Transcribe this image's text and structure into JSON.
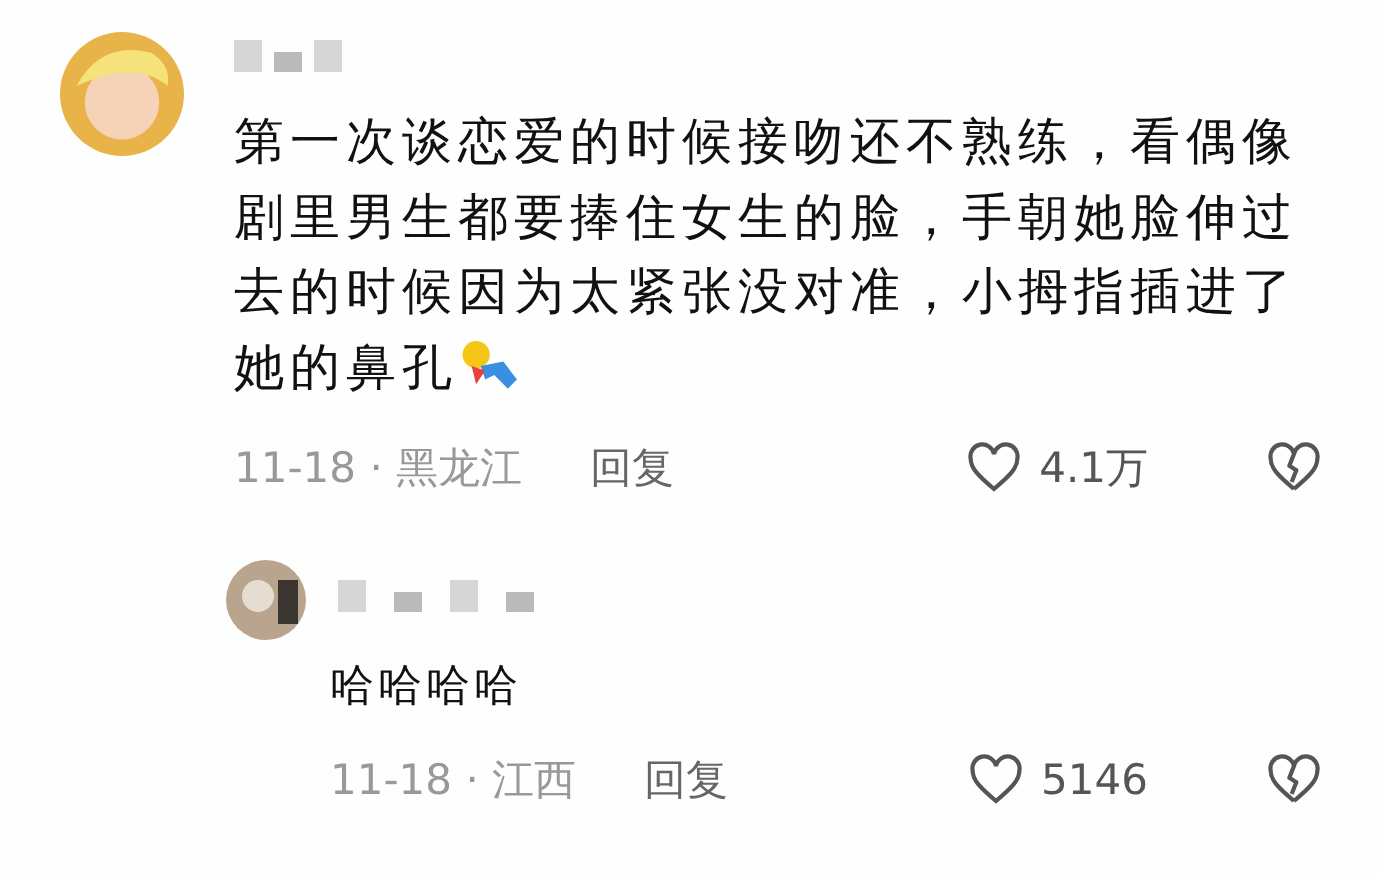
{
  "comments": [
    {
      "text_lines": [
        "第一次谈恋爱的时候接吻还不熟练，看偶像",
        "剧里男生都要捧住女生的脸，手朝她脸伸过",
        "去的时候因为太紧张没对准，小拇指插进了",
        "她的鼻孔"
      ],
      "date_location": "11-18 · 黑龙江",
      "reply_label": "回复",
      "likes": "4.1万",
      "replies": [
        {
          "text": "哈哈哈哈",
          "date_location": "11-18 · 江西",
          "reply_label": "回复",
          "likes": "5146"
        }
      ]
    }
  ]
}
